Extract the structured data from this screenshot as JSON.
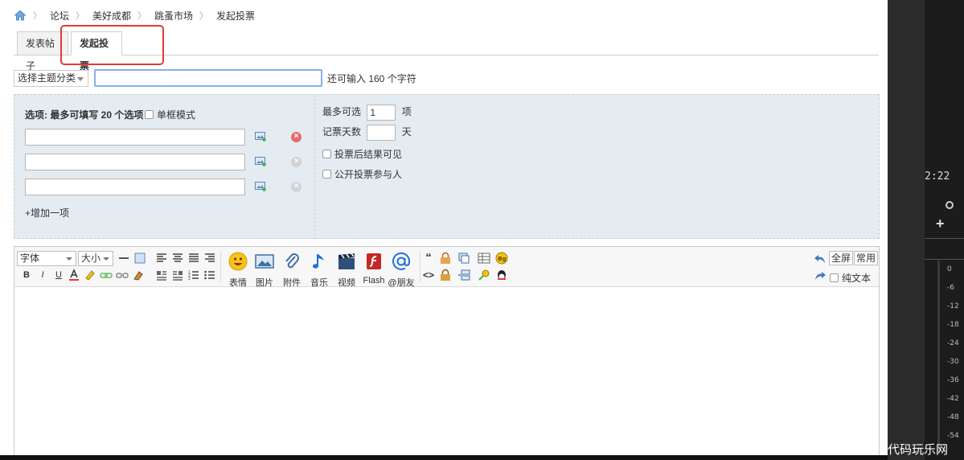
{
  "breadcrumb": {
    "items": [
      "论坛",
      "美好成都",
      "跳蚤市场",
      "发起投票"
    ]
  },
  "tabs": [
    {
      "label": "发表帖子",
      "active": false
    },
    {
      "label": "发起投票",
      "active": true
    }
  ],
  "subject": {
    "category_select": "选择主题分类",
    "title_value": "",
    "char_hint": "还可输入 160 个字符"
  },
  "poll": {
    "title": "选项: 最多可填写 20 个选项",
    "single_mode_label": "单框模式",
    "add_item": "+增加一项",
    "max_choices_label": "最多可选",
    "max_choices_value": "1",
    "max_choices_unit": "项",
    "days_label": "记票天数",
    "days_value": "",
    "days_unit": "天",
    "visible_after_vote": "投票后结果可见",
    "public_voters": "公开投票参与人"
  },
  "editor": {
    "font_select": "字体",
    "size_select": "大小",
    "buttons": {
      "emoji": "表情",
      "image": "图片",
      "attachment": "附件",
      "music": "音乐",
      "video": "视频",
      "flash": "Flash",
      "at_friend": "@朋友",
      "fullscreen": "全屏",
      "common": "常用",
      "plaintext": "纯文本"
    },
    "format_glyphs": {
      "bold": "B",
      "italic": "I",
      "underline": "U",
      "quote": "“",
      "code": "<>"
    }
  },
  "side_panel": {
    "time": "2:22",
    "db_ticks": [
      "0",
      "-6",
      "-12",
      "-18",
      "-24",
      "-30",
      "-36",
      "-42",
      "-48",
      "-54"
    ],
    "watermark": "代码玩乐网"
  },
  "colors": {
    "accent_border": "#8aaee8",
    "highlight": "#e53935",
    "poll_bg": "#e4ecf1"
  }
}
